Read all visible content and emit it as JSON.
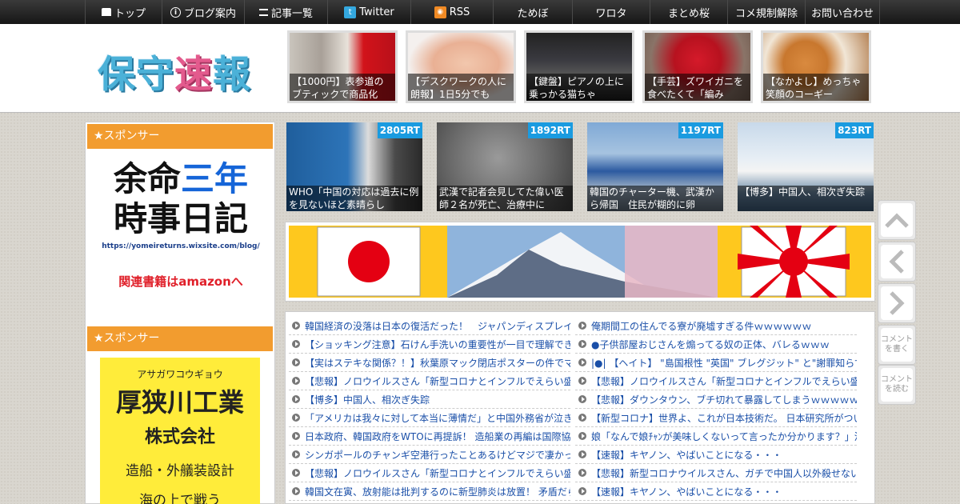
{
  "nav": {
    "items": [
      {
        "label": "トップ",
        "icon": "home-icon"
      },
      {
        "label": "ブログ案内",
        "icon": "info-icon"
      },
      {
        "label": "記事一覧",
        "icon": "list-icon"
      },
      {
        "label": "Twitter",
        "icon": "twitter-icon"
      },
      {
        "label": "RSS",
        "icon": "rss-icon"
      },
      {
        "label": "ためぼ"
      },
      {
        "label": "ワロタ"
      },
      {
        "label": "まとめ桜"
      },
      {
        "label": "コメ規制解除"
      },
      {
        "label": "お問い合わせ"
      }
    ]
  },
  "header": {
    "logo_text_a": "保守",
    "logo_text_b": "速",
    "logo_text_c": "報",
    "thumbs": [
      "【1000円】表参道のブティックで商品化",
      "【デスクワークの人に朗報】1日5分でも",
      "【鍵盤】ピアノの上に乗っかる猫ちゃ",
      "【手芸】ズワイガニを食べたくて「編み",
      "【なかよし】めっちゃ笑顔のコーギー"
    ]
  },
  "sidebar": {
    "sponsor_label_1": "★スポンサー",
    "sponsor_label_2": "★スポンサー",
    "ad1": {
      "line1a": "余命",
      "line1b": "三年",
      "line2": "時事日記",
      "url": "https://yomeireturns.wixsite.com/blog/",
      "amazon": "関連書籍はamazonへ"
    },
    "ad2": {
      "kana": "アサガワコウギョウ",
      "name": "厚狭川工業",
      "kk": "株式会社",
      "biz": "造船・外艤装設計",
      "more": "海の上で戦う"
    }
  },
  "rt_items": [
    {
      "count": "2805RT",
      "caption": "WHO「中国の対応は過去に例を見ないほど素晴らし"
    },
    {
      "count": "1892RT",
      "caption": "武漢で記者会見してた偉い医師２名が死亡、治療中に"
    },
    {
      "count": "1197RT",
      "caption": "韓国のチャーター機、武漢から帰国　住民が糊的に卵"
    },
    {
      "count": "823RT",
      "caption": "【博多】中国人、相次ぎ失踪"
    }
  ],
  "list_left": [
    "韓国経済の没落は日本の復活だった！　ジャパンディスプレイ",
    "【ショッキング注意】石けん手洗いの重要性が一目で理解でき",
    "【実はステキな関係？！】秋葉原マック閉店ポスターの件でマ",
    "【悲報】ノロウイルスさん「新型コロナとインフルでえらい盛",
    "【博多】中国人、相次ぎ失踪",
    "「アメリカは我々に対して本当に薄情だ」と中国外務省が泣き",
    "日本政府、韓国政府をWTOに再提訴！ 造船業の再編は国際協定",
    "シンガポールのチャンギ空港行ったことあるけどマジで凄かっ",
    "【悲報】ノロウイルスさん「新型コロナとインフルでえらい盛",
    "韓国文在寅、放射能は批判するのに新型肺炎は放置！ 矛盾だら"
  ],
  "list_right": [
    "俺期間工の住んでる寮が廃墟すぎる件ｗｗｗｗｗｗ",
    "●子供部屋おじさんを煽ってる奴の正体、バレるｗｗｗ",
    "|●| 【ヘイト】 \"島国根性 \"英国\" ブレグジット\" と\"謝罪知らず",
    "【悲報】ノロウイルスさん「新型コロナとインフルでえらい盛",
    "【悲報】ダウンタウン、ブチ切れて暴露してしまうｗｗｗｗｗ",
    "【新型コロナ】世界よ、これが日本技術だ。 日本研究所がつい",
    "娘「なんで娘ﾁｬﾝが美味しくないって言ったか分かります？」汝",
    "【速報】キヤノン、やばいことになる・・・",
    "【悲報】新型コロナウイルスさん、ガチで中国人以外殺せない",
    "【速報】キヤノン、やばいことになる・・・"
  ],
  "side_buttons": {
    "comment_write": "コメントを書く",
    "comment_read": "コメントを読む"
  },
  "colors": {
    "accent_orange": "#f29c2f",
    "badge_blue": "#1a9be0",
    "link_blue": "#1a4fa8"
  }
}
